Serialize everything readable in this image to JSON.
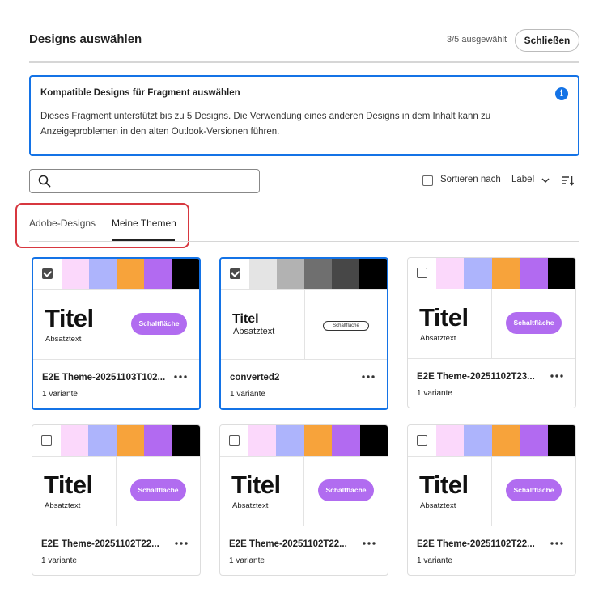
{
  "header": {
    "title": "Designs auswählen",
    "count": "3/5 ausgewählt",
    "close_label": "Schließen"
  },
  "info": {
    "title": "Kompatible Designs für Fragment auswählen",
    "text": "Dieses Fragment unterstützt bis zu 5 Designs. Die Verwendung eines anderen Designs in dem Inhalt kann zu Anzeigeproblemen in den alten Outlook-Versionen führen."
  },
  "search": {
    "placeholder": "",
    "value": ""
  },
  "sort": {
    "label": "Sortieren nach",
    "selected": "Label"
  },
  "tabs": [
    {
      "label": "Adobe-Designs",
      "active": false
    },
    {
      "label": "Meine Themen",
      "active": true
    }
  ],
  "colors": {
    "accent": "#1473e6",
    "highlight": "#d7373f",
    "button_purple": "#b16cf0"
  },
  "cards": [
    {
      "name": "E2E Theme-20251103T102...",
      "variant": "1 variante",
      "checked": true,
      "swatches": [
        "#fbd8fb",
        "#adb4fc",
        "#f7a33b",
        "#b26af1",
        "#000000"
      ],
      "preview_title": "Titel",
      "preview_sub": "Absatztext",
      "preview_button": "Schaltfläche",
      "preview_style": "bold"
    },
    {
      "name": "converted2",
      "variant": "1 variante",
      "checked": true,
      "swatches": [
        "#e4e4e4",
        "#b2b2b2",
        "#6f6f6f",
        "#474747",
        "#000000"
      ],
      "preview_title": "Titel",
      "preview_sub": "Absatztext",
      "preview_button": "Schaltfläche",
      "preview_style": "plain"
    },
    {
      "name": "E2E Theme-20251102T23...",
      "variant": "1 variante",
      "checked": false,
      "swatches": [
        "#fbd8fb",
        "#adb4fc",
        "#f7a33b",
        "#b26af1",
        "#000000"
      ],
      "preview_title": "Titel",
      "preview_sub": "Absatztext",
      "preview_button": "Schaltfläche",
      "preview_style": "bold"
    },
    {
      "name": "E2E Theme-20251102T22...",
      "variant": "1 variante",
      "checked": false,
      "swatches": [
        "#fbd8fb",
        "#adb4fc",
        "#f7a33b",
        "#b26af1",
        "#000000"
      ],
      "preview_title": "Titel",
      "preview_sub": "Absatztext",
      "preview_button": "Schaltfläche",
      "preview_style": "bold"
    },
    {
      "name": "E2E Theme-20251102T22...",
      "variant": "1 variante",
      "checked": false,
      "swatches": [
        "#fbd8fb",
        "#adb4fc",
        "#f7a33b",
        "#b26af1",
        "#000000"
      ],
      "preview_title": "Titel",
      "preview_sub": "Absatztext",
      "preview_button": "Schaltfläche",
      "preview_style": "bold"
    },
    {
      "name": "E2E Theme-20251102T22...",
      "variant": "1 variante",
      "checked": false,
      "swatches": [
        "#fbd8fb",
        "#adb4fc",
        "#f7a33b",
        "#b26af1",
        "#000000"
      ],
      "preview_title": "Titel",
      "preview_sub": "Absatztext",
      "preview_button": "Schaltfläche",
      "preview_style": "bold"
    }
  ]
}
